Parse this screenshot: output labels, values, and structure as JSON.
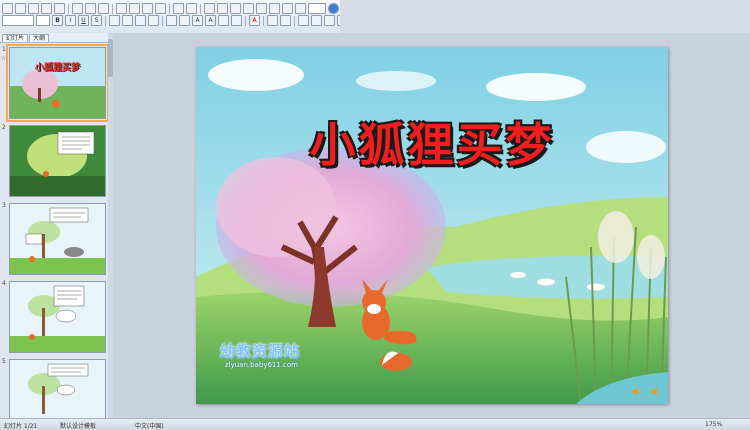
{
  "tabs": {
    "slides": "幻灯片",
    "outline": "大纲"
  },
  "thumbnails": [
    {
      "num": "1",
      "title": "小狐狸买梦"
    },
    {
      "num": "2"
    },
    {
      "num": "3"
    },
    {
      "num": "4"
    },
    {
      "num": "5"
    }
  ],
  "slide": {
    "title": "小狐狸买梦",
    "watermark": "幼教资源站",
    "watermark_url": "zlyuan.baby611.com"
  },
  "status": {
    "slide_pos": "幻灯片 1/21",
    "design": "默认设计模板",
    "language": "中文(中国)",
    "zoom": "175%"
  },
  "colors": {
    "title_red": "#ef1f1f",
    "selection": "#f7a84a"
  }
}
